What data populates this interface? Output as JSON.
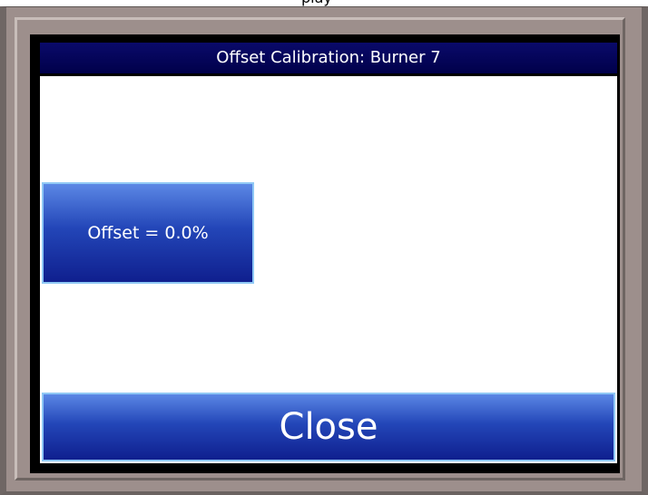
{
  "caption": {
    "partial_text": "play"
  },
  "dialog": {
    "title": "Offset Calibration: Burner 7",
    "offset_button_label": "Offset = 0.0%",
    "close_button_label": "Close"
  },
  "colors": {
    "bezel": "#9d8f8c",
    "title_bar": "#00004a",
    "button_top": "#5b87e5",
    "button_bottom": "#0f1f8e",
    "button_border": "#8fc8f5"
  }
}
